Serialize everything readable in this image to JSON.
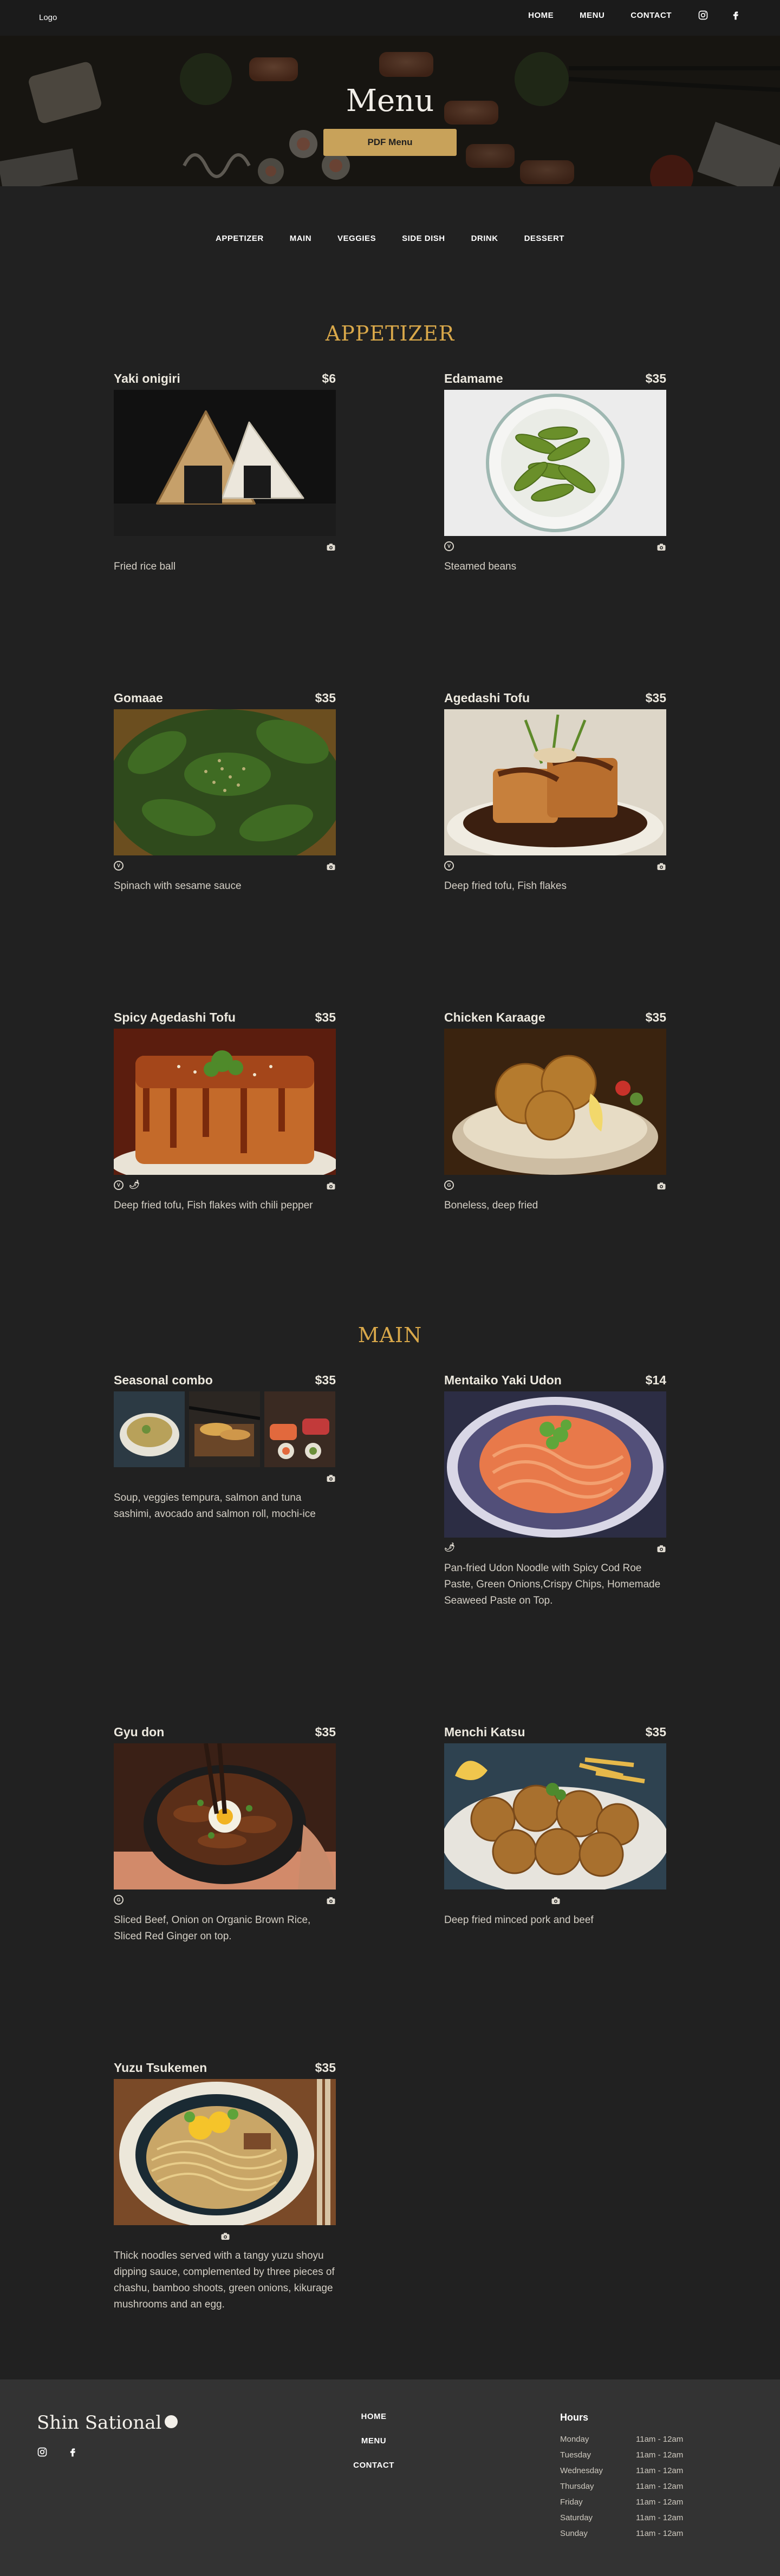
{
  "header": {
    "logo": "Logo",
    "nav": [
      "HOME",
      "MENU",
      "CONTACT"
    ]
  },
  "hero": {
    "title": "Menu",
    "pdf_button": "PDF Menu"
  },
  "categories": [
    "APPETIZER",
    "MAIN",
    "VEGGIES",
    "SIDE DISH",
    "DRINK",
    "DESSERT"
  ],
  "sections": {
    "appetizer": "APPETIZER",
    "main": "MAIN"
  },
  "items": {
    "yaki_onigiri": {
      "name": "Yaki onigiri",
      "price": "$6",
      "desc": "Fried rice ball"
    },
    "edamame": {
      "name": "Edamame",
      "price": "$35",
      "desc": "Steamed beans",
      "badge": "V"
    },
    "gomaae": {
      "name": "Gomaae",
      "price": "$35",
      "desc": "Spinach with sesame sauce",
      "badge": "V"
    },
    "agedashi_tofu": {
      "name": "Agedashi Tofu",
      "price": "$35",
      "desc": "Deep fried tofu, Fish flakes",
      "badge": "V"
    },
    "spicy_agedashi_tofu": {
      "name": "Spicy Agedashi Tofu",
      "price": "$35",
      "desc": "Deep fried tofu, Fish flakes with chili pepper",
      "badge": "V",
      "badge2": "🌶"
    },
    "chicken_karaage": {
      "name": "Chicken Karaage",
      "price": "$35",
      "desc": "Boneless, deep fried",
      "badge": "G"
    },
    "seasonal_combo": {
      "name": "Seasonal combo",
      "price": "$35",
      "desc": "Soup, veggies tempura, salmon and tuna sashimi, avocado and salmon roll, mochi-ice"
    },
    "mentaiko_yaki_udon": {
      "name": "Mentaiko Yaki Udon",
      "price": "$14",
      "desc": "Pan-fried Udon Noodle with Spicy Cod Roe Paste, Green Onions,Crispy Chips, Homemade Seaweed Paste on Top.",
      "badge2": "🌶"
    },
    "gyu_don": {
      "name": "Gyu don",
      "price": "$35",
      "desc": "Sliced Beef, Onion on Organic Brown Rice, Sliced Red Ginger on top.",
      "badge": "G"
    },
    "menchi_katsu": {
      "name": "Menchi Katsu",
      "price": "$35",
      "desc": "Deep fried minced pork and beef"
    },
    "yuzu_tsukemen": {
      "name": "Yuzu Tsukemen",
      "price": "$35",
      "desc": "Thick noodles served with a tangy yuzu shoyu dipping sauce, complemented by three pieces of chashu, bamboo shoots, green onions, kikurage mushrooms and an egg."
    }
  },
  "footer": {
    "brand": "Shin Sational",
    "nav": [
      "HOME",
      "MENU",
      "CONTACT"
    ],
    "hours_title": "Hours",
    "hours": [
      {
        "day": "Monday",
        "time": "11am - 12am"
      },
      {
        "day": "Tuesday",
        "time": "11am - 12am"
      },
      {
        "day": "Wednesday",
        "time": "11am - 12am"
      },
      {
        "day": "Thursday",
        "time": "11am - 12am"
      },
      {
        "day": "Friday",
        "time": "11am - 12am"
      },
      {
        "day": "Saturday",
        "time": "11am - 12am"
      },
      {
        "day": "Sunday",
        "time": "11am - 12am"
      }
    ]
  },
  "colors": {
    "background": "#212121",
    "accent_gold": "#d9a84a",
    "button_gold": "#c8a25a",
    "footer_bg": "#333333"
  },
  "icons": {
    "social": [
      "instagram-icon",
      "facebook-icon"
    ],
    "item": [
      "vegan-icon",
      "gluten-free-icon",
      "chili-icon",
      "camera-icon"
    ]
  }
}
